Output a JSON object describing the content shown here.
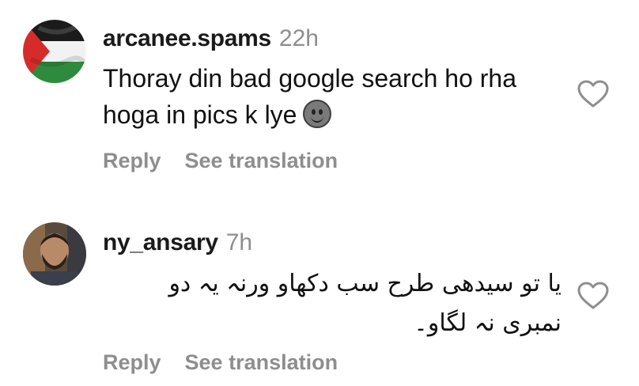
{
  "comments": [
    {
      "username": "arcanee.spams",
      "time": "22h",
      "text": "Thoray din bad google search ho rha hoga in pics k lye",
      "emoji": "slightly-smiling-face-icon",
      "avatar": "palestine-flag-avatar",
      "reply_label": "Reply",
      "translate_label": "See translation"
    },
    {
      "username": "ny_ansary",
      "time": "7h",
      "text": "یا تو سیدھی طرح سب دکھاو ورنہ یہ دو نمبری نہ لگاو۔",
      "avatar": "profile-photo-avatar",
      "reply_label": "Reply",
      "translate_label": "See translation"
    }
  ],
  "colors": {
    "secondary_text": "#8e8e8e",
    "primary_text": "#111111",
    "background": "#ffffff"
  }
}
